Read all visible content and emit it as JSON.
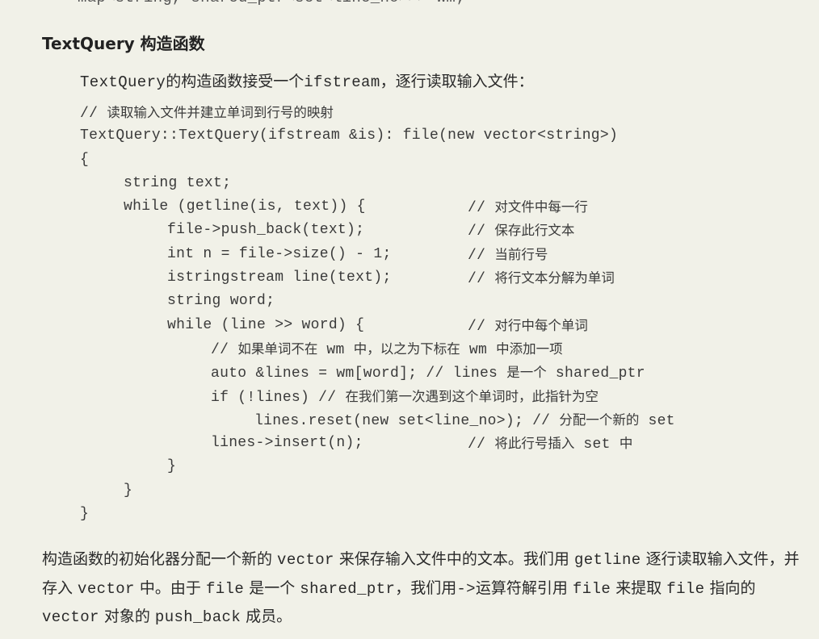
{
  "cut_top_line": "map<string, shared_ptr<set<line_no>>> wm;",
  "heading": "TextQuery 构造函数",
  "intro": {
    "before": "TextQuery",
    "middle": "的构造函数接受一个",
    "code": "ifstream",
    "after": "，逐行读取输入文件："
  },
  "code": [
    {
      "indent": 0,
      "code": "",
      "comment": "// 读取输入文件并建立单词到行号的映射",
      "full_comment": true
    },
    {
      "indent": 0,
      "code": "TextQuery::TextQuery(ifstream &is): file(new vector<string>)",
      "comment": ""
    },
    {
      "indent": 0,
      "code": "{",
      "comment": ""
    },
    {
      "indent": 1,
      "code": "string text;",
      "comment": ""
    },
    {
      "indent": 1,
      "code": "while (getline(is, text)) {",
      "comment": "// 对文件中每一行"
    },
    {
      "indent": 2,
      "code": "file->push_back(text);",
      "comment": "// 保存此行文本"
    },
    {
      "indent": 2,
      "code": "int n = file->size() - 1;",
      "comment": "// 当前行号"
    },
    {
      "indent": 2,
      "code": "istringstream line(text);",
      "comment": "// 将行文本分解为单词"
    },
    {
      "indent": 2,
      "code": "string word;",
      "comment": ""
    },
    {
      "indent": 2,
      "code": "while (line >> word) {",
      "comment": "// 对行中每个单词"
    },
    {
      "indent": 3,
      "code": "",
      "comment": "// 如果单词不在 wm 中，以之为下标在 wm 中添加一项",
      "full_comment": true
    },
    {
      "indent": 3,
      "code": "auto &lines = wm[word];",
      "comment": "// lines 是一个 shared_ptr",
      "inline": true
    },
    {
      "indent": 3,
      "code": "if (!lines)",
      "comment": "// 在我们第一次遇到这个单词时，此指针为空",
      "inline": true
    },
    {
      "indent": 4,
      "code": "lines.reset(new set<line_no>);",
      "comment": "// 分配一个新的 set",
      "inline": true
    },
    {
      "indent": 3,
      "code": "lines->insert(n);",
      "comment": "// 将此行号插入 set 中"
    },
    {
      "indent": 2,
      "code": "}",
      "comment": ""
    },
    {
      "indent": 1,
      "code": "}",
      "comment": ""
    },
    {
      "indent": 0,
      "code": "}",
      "comment": ""
    }
  ],
  "paragraph": [
    {
      "t": "构造函数的初始化器分配一个新的 "
    },
    {
      "c": "vector"
    },
    {
      "t": " 来保存输入文件中的文本。我们用 "
    },
    {
      "c": "getline"
    },
    {
      "t": " 逐行读取输入文件，并存入 "
    },
    {
      "c": "vector"
    },
    {
      "t": " 中。由于 "
    },
    {
      "c": "file"
    },
    {
      "t": " 是一个 "
    },
    {
      "c": "shared_ptr"
    },
    {
      "t": "，我们用"
    },
    {
      "c": "->"
    },
    {
      "t": "运算符解引用 "
    },
    {
      "c": "file"
    },
    {
      "t": " 来提取 "
    },
    {
      "c": "file"
    },
    {
      "t": " 指向的 "
    },
    {
      "c": "vector"
    },
    {
      "t": " 对象的 "
    },
    {
      "c": "push_back"
    },
    {
      "t": " 成员。"
    }
  ]
}
